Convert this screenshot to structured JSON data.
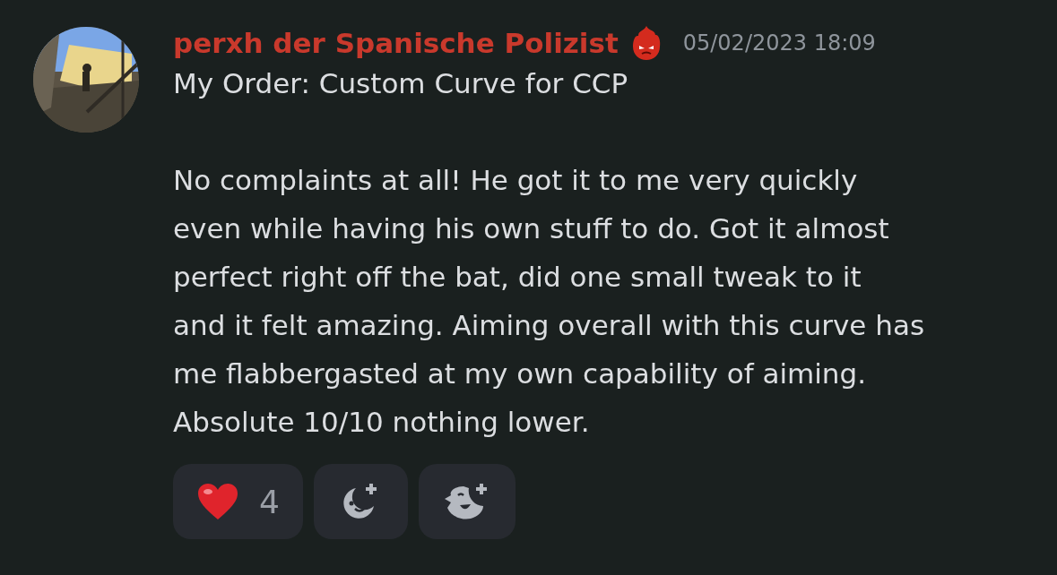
{
  "message": {
    "author": "perxh der Spanische Polizist",
    "timestamp": "05/02/2023 18:09",
    "title": "My Order: Custom Curve for CCP",
    "body_lines": [
      "No complaints at all! He got it to me very quickly",
      "even while having his own stuff to do. Got it almost",
      "perfect right off the bat, did one small tweak to it",
      "and it felt amazing. Aiming overall with this curve has",
      "me flabbergasted at my own capability of aiming.",
      "Absolute 10/10 nothing lower."
    ]
  },
  "reactions": [
    {
      "kind": "emoji",
      "count": "4"
    },
    {
      "kind": "add-reaction"
    },
    {
      "kind": "add-super-reaction"
    }
  ]
}
